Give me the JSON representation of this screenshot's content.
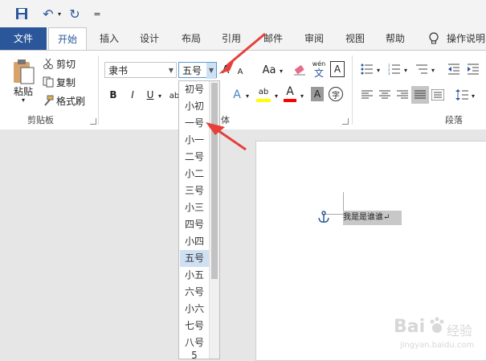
{
  "qat": {
    "undo_label": "↶",
    "redo_label": "↻",
    "customize": "="
  },
  "tabs": [
    "文件",
    "开始",
    "插入",
    "设计",
    "布局",
    "引用",
    "邮件",
    "审阅",
    "视图",
    "帮助",
    "操作说明"
  ],
  "clipboard": {
    "paste": "粘贴",
    "cut": "剪切",
    "copy": "复制",
    "format_painter": "格式刷",
    "group_label": "剪贴板"
  },
  "font": {
    "font_name": "隶书",
    "font_size": "五号",
    "group_label": "体",
    "grow": "A",
    "shrink": "A",
    "case": "Aa",
    "wen": "wén",
    "wen2": "文",
    "border_a": "A",
    "bold": "B",
    "italic": "I",
    "underline": "U",
    "ab": "ab",
    "text_effect": "A",
    "highlight": "ab",
    "color_a": "A",
    "shade_a": "A",
    "enclose": "字"
  },
  "paragraph": {
    "group_label": "段落"
  },
  "document": {
    "text": "我是是谁谁",
    "para_mark": "↵"
  },
  "dropdown": {
    "items": [
      "初号",
      "小初",
      "一号",
      "小一",
      "二号",
      "小二",
      "三号",
      "小三",
      "四号",
      "小四",
      "五号",
      "小五",
      "六号",
      "小六",
      "七号",
      "八号",
      "5"
    ],
    "selected": "五号"
  },
  "watermark": {
    "brand": "Bai",
    "brand2": "经验",
    "url": "jingyan.baidu.com"
  },
  "colors": {
    "accent": "#2b579a",
    "arrow": "#e5403b",
    "highlight_bar": "#ffff00",
    "font_red": "#ff0000"
  }
}
